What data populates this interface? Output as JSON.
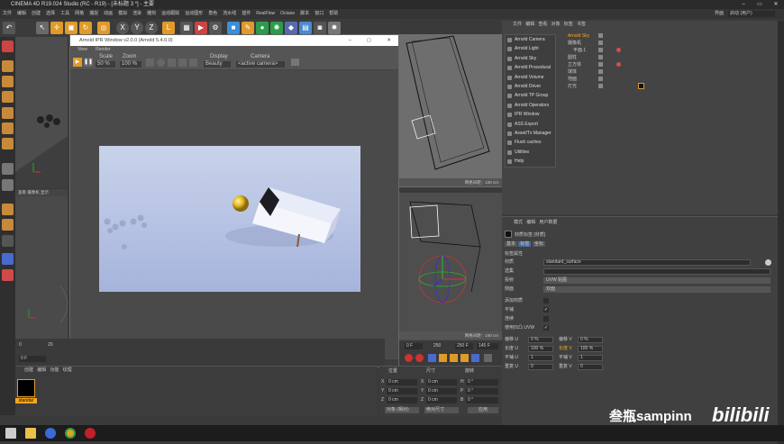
{
  "app": {
    "title": "CINEMA 4D R19.024 Studio (RC - R19) - [未标题 3 *] - 主要",
    "layout_label": "界面",
    "layout_value": "启动 (用户)"
  },
  "menu": [
    "文件",
    "编辑",
    "创建",
    "选择",
    "工具",
    "网格",
    "捕捉",
    "动画",
    "模拟",
    "渲染",
    "雕刻",
    "运动跟踪",
    "运动图形",
    "角色",
    "流水线",
    "插件",
    "RealFlow",
    "Octane",
    "脚本",
    "窗口",
    "帮助"
  ],
  "ipr": {
    "title": "Arnold IPR Window v2.0.0 (Arnold 5.4.0.0)",
    "menu": [
      "View",
      "Render"
    ],
    "scale_label": "Scale",
    "scale_value": "50 %",
    "zoom_label": "Zoom",
    "zoom_value": "100 %",
    "display_label": "Display",
    "display_value": "Beauty",
    "camera_label": "Camera",
    "camera_value": "<active camera>",
    "status": "00:00:02  Samples: [3/2/2/2/2/2]  Res: 640x360  Mem: 1522.91 MB"
  },
  "arnold_menu": [
    "Arnold Camera",
    "Arnold Light",
    "Arnold Sky",
    "Arnold Procedural",
    "Arnold Volume",
    "Arnold Driver",
    "Arnold TP Group",
    "Arnold Operators",
    "IPR Window",
    "ASS Export",
    "Asset/Tx Manager",
    "Flush caches",
    "Utilities",
    "Help"
  ],
  "objects": {
    "tabs": [
      "文件",
      "编辑",
      "查看",
      "对象",
      "标签",
      "书签"
    ],
    "tree": [
      "Arnold Sky",
      "摄像机",
      "平面.1",
      "圆柱",
      "立方体",
      "球体",
      "地面",
      "灯光"
    ]
  },
  "viewport": {
    "label_top": "网格间距：100 cm",
    "label_bottom": "网格间距：100 cm",
    "left_tabs": [
      "查看",
      "摄像机",
      "显示"
    ]
  },
  "attributes": {
    "tabs": [
      "模式",
      "编辑",
      "用户数据"
    ],
    "material_name": "材质标签 [材质]",
    "tab_basic": "基本",
    "tab_tag": "标签",
    "tab_coord": "坐标",
    "section": "标签属性",
    "rows": [
      {
        "label": "材质",
        "value": "standard_surface"
      },
      {
        "label": "选集",
        "value": ""
      },
      {
        "label": "投射",
        "value": "UVW 贴图"
      },
      {
        "label": "侧面",
        "value": "双面"
      },
      {
        "label": "添加材质",
        "value": ""
      },
      {
        "label": "平铺",
        "value": ""
      },
      {
        "label": "连续",
        "value": ""
      },
      {
        "label": "使用凹凸 UVW",
        "value": ""
      }
    ],
    "offset": [
      {
        "label": "偏移 U",
        "value": "0 %"
      },
      {
        "label": "偏移 V",
        "value": "0 %"
      },
      {
        "label": "长度 U",
        "value": "100 %"
      },
      {
        "label": "长度 V",
        "value": "100 %"
      },
      {
        "label": "平铺 U",
        "value": "1"
      },
      {
        "label": "平铺 V",
        "value": "1"
      },
      {
        "label": "重复 U",
        "value": "0"
      },
      {
        "label": "重复 V",
        "value": "0"
      }
    ]
  },
  "timeline": {
    "start": "0",
    "end": "20",
    "frame": "0 F",
    "f1": "0 F",
    "f2": "250",
    "f3": "250 F",
    "fps": "145 F"
  },
  "materials": {
    "tabs": [
      "创建",
      "编辑",
      "功能",
      "纹理"
    ],
    "items": [
      {
        "name": "standar"
      }
    ]
  },
  "coords": {
    "headers": [
      "位置",
      "尺寸",
      "旋转"
    ],
    "rows": [
      [
        "X",
        "0 cm",
        "X",
        "0 cm",
        "H",
        "0 °"
      ],
      [
        "Y",
        "0 cm",
        "Y",
        "0 cm",
        "P",
        "0 °"
      ],
      [
        "Z",
        "0 cm",
        "Z",
        "0 cm",
        "B",
        "0 °"
      ]
    ],
    "mode": "对象 (相对)",
    "size_mode": "绝对尺寸",
    "apply": "应用"
  },
  "watermark": "叁瓶sampinn",
  "brand": "bilibili",
  "colors": {
    "accent": "#e09a2a",
    "render_bg": "#b6c3e6",
    "selected": "#f6a623"
  }
}
